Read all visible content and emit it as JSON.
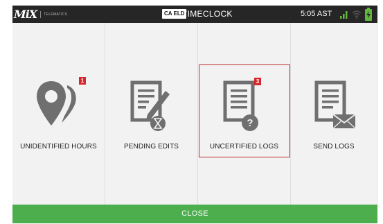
{
  "status_bar": {
    "brand_logo": "MiX",
    "brand_tagline": "TELEMATICS",
    "eld_badge": "CA ELD",
    "title": "TIMECLOCK",
    "time": "5:05 AST",
    "icons": [
      "signal-icon",
      "wifi-icon",
      "battery-icon"
    ],
    "colors": {
      "background": "#262626",
      "signal": "#5fb83a",
      "battery": "#5fb83a"
    }
  },
  "tiles": [
    {
      "id": "unidentified-hours",
      "label": "UNIDENTIFIED HOURS",
      "icon": "map-pin-icon",
      "badge": "1"
    },
    {
      "id": "pending-edits",
      "label": "PENDING EDITS",
      "icon": "document-edit-icon",
      "badge": ""
    },
    {
      "id": "uncertified-logs",
      "label": "UNCERTIFIED LOGS",
      "icon": "document-question-icon",
      "badge": "3",
      "selected": true
    },
    {
      "id": "send-logs",
      "label": "SEND LOGS",
      "icon": "document-mail-icon",
      "badge": ""
    }
  ],
  "close_button": {
    "label": "CLOSE"
  },
  "colors": {
    "icon_gray": "#6f6f6f",
    "badge_red": "#d7262d",
    "selection_border": "#c0272d",
    "close_bar": "#4cae4c",
    "panel_background": "#f2f2f2"
  }
}
